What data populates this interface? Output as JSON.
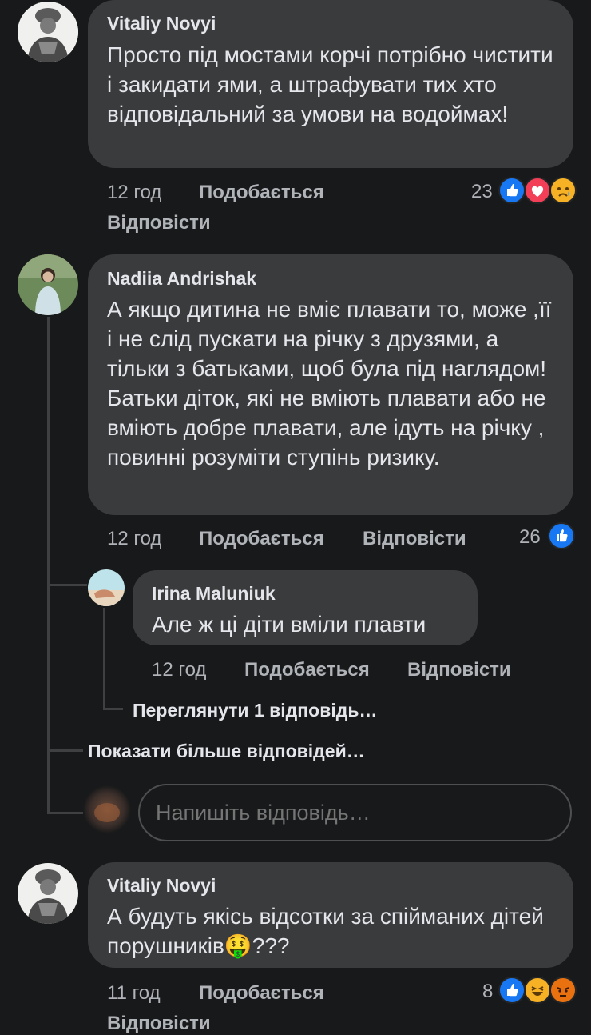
{
  "comments": [
    {
      "author": "Vitaliy Novyi",
      "text": "Просто під мостами корчі потрібно чистити і закидати ями, а штрафувати тих хто відповідальний за умови на водоймах!",
      "time": "12 год",
      "like_label": "Подобається",
      "reply_label": "Відповісти",
      "reaction_count": "23",
      "reactions": [
        "like-icon",
        "love-icon",
        "sad-icon"
      ]
    },
    {
      "author": "Nadiia Andrishak",
      "text": "А якщо дитина не вміє плавати то, може ,її і не слід пускати на річку з друзями, а тільки з батьками, щоб була під наглядом! Батьки  діток, які не вміють плавати або не вміють добре плавати, але ідуть на річку , повинні розуміти ступінь ризику.",
      "time": "12 год",
      "like_label": "Подобається",
      "reply_label": "Відповісти",
      "reaction_count": "26",
      "reactions": [
        "like-icon"
      ]
    },
    {
      "author": "Irina Maluniuk",
      "text": "Але ж ці діти вміли плавти",
      "time": "12 год",
      "like_label": "Подобається",
      "reply_label": "Відповісти"
    },
    {
      "author": "Vitaliy Novyi",
      "text": "А будуть якісь відсотки за спійманих дітей порушників",
      "emoji_after": "🤑",
      "text_suffix": "???",
      "time": "11 год",
      "like_label": "Подобається",
      "reply_label": "Відповісти",
      "reaction_count": "8",
      "reactions": [
        "like-icon",
        "haha-icon",
        "angry-icon"
      ]
    }
  ],
  "links": {
    "view_reply": "Переглянути 1 відповідь…",
    "show_more": "Показати більше відповідей…"
  },
  "reply_input": {
    "placeholder": "Напишіть відповідь…"
  },
  "colors": {
    "background": "#18191a",
    "bubble": "#3a3b3c",
    "like": "#1877f2",
    "love": "#f33e58",
    "sad": "#f7b125"
  }
}
